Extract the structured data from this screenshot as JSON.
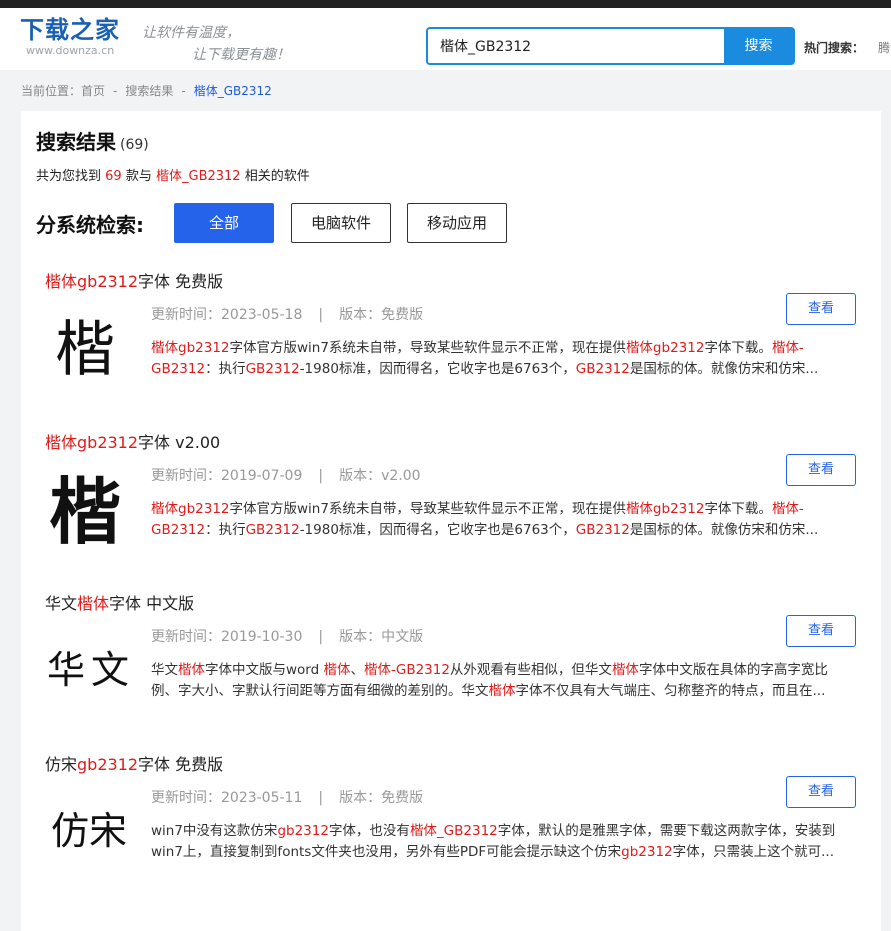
{
  "header": {
    "logo_title": "下载之家",
    "logo_url": "www.downza.cn",
    "slogan_line1": "让软件有温度，",
    "slogan_line2": "让下载更有趣！",
    "search_value": "楷体_GB2312",
    "search_button": "搜索",
    "hot_label": "热门搜索：",
    "hot_item": "腾讯"
  },
  "breadcrumb": {
    "prefix": "当前位置：",
    "home": "首页",
    "sep": "-",
    "results": "搜索结果",
    "current": "楷体_GB2312"
  },
  "results": {
    "title": "搜索结果",
    "count": "(69)",
    "summary_prefix": "共为您找到",
    "summary_count": "69",
    "summary_mid": "款与",
    "summary_keyword": "楷体_GB2312",
    "summary_suffix": "相关的软件"
  },
  "filter": {
    "label": "分系统检索:",
    "buttons": [
      "全部",
      "电脑软件",
      "移动应用"
    ]
  },
  "labels": {
    "updated": "更新时间：",
    "version": "版本：",
    "bar": "|",
    "view": "查看"
  },
  "items": [
    {
      "title_parts": [
        {
          "t": "楷体gb2312",
          "hl": true
        },
        {
          "t": "字体 免费版",
          "hl": false
        }
      ],
      "thumb_text": "楷",
      "date": "2023-05-18",
      "version": "免费版",
      "desc_parts": [
        {
          "t": "楷体gb2312",
          "hl": true
        },
        {
          "t": "字体官方版win7系统未自带，导致某些软件显示不正常，现在提供",
          "hl": false
        },
        {
          "t": "楷体gb2312",
          "hl": true
        },
        {
          "t": "字体下载。",
          "hl": false
        },
        {
          "t": "楷体-GB2312",
          "hl": true
        },
        {
          "t": "：执行",
          "hl": false
        },
        {
          "t": "GB2312",
          "hl": true
        },
        {
          "t": "-1980标准，因而得名，它收字也是6763个，",
          "hl": false
        },
        {
          "t": "GB2312",
          "hl": true
        },
        {
          "t": "是国标的体。就像仿宋和仿宋...",
          "hl": false
        }
      ]
    },
    {
      "title_parts": [
        {
          "t": "楷体gb2312",
          "hl": true
        },
        {
          "t": "字体 v2.00",
          "hl": false
        }
      ],
      "thumb_text": "楷",
      "date": "2019-07-09",
      "version": "v2.00",
      "desc_parts": [
        {
          "t": "楷体gb2312",
          "hl": true
        },
        {
          "t": "字体官方版win7系统未自带，导致某些软件显示不正常，现在提供",
          "hl": false
        },
        {
          "t": "楷体gb2312",
          "hl": true
        },
        {
          "t": "字体下载。",
          "hl": false
        },
        {
          "t": "楷体-GB2312",
          "hl": true
        },
        {
          "t": "：执行",
          "hl": false
        },
        {
          "t": "GB2312",
          "hl": true
        },
        {
          "t": "-1980标准，因而得名，它收字也是6763个，",
          "hl": false
        },
        {
          "t": "GB2312",
          "hl": true
        },
        {
          "t": "是国标的体。就像仿宋和仿宋...",
          "hl": false
        }
      ]
    },
    {
      "title_parts": [
        {
          "t": "华文",
          "hl": false
        },
        {
          "t": "楷体",
          "hl": true
        },
        {
          "t": "字体 中文版",
          "hl": false
        }
      ],
      "thumb_text": "华文",
      "date": "2019-10-30",
      "version": "中文版",
      "desc_parts": [
        {
          "t": "华文",
          "hl": false
        },
        {
          "t": "楷体",
          "hl": true
        },
        {
          "t": "字体中文版与word ",
          "hl": false
        },
        {
          "t": "楷体",
          "hl": true
        },
        {
          "t": "、",
          "hl": false
        },
        {
          "t": "楷体-GB2312",
          "hl": true
        },
        {
          "t": "从外观看有些相似，但华文",
          "hl": false
        },
        {
          "t": "楷体",
          "hl": true
        },
        {
          "t": "字体中文版在具体的字高字宽比例、字大小、字默认行间距等方面有细微的差别的。华文",
          "hl": false
        },
        {
          "t": "楷体",
          "hl": true
        },
        {
          "t": "字体不仅具有大气端庄、匀称整齐的特点，而且在...",
          "hl": false
        }
      ]
    },
    {
      "title_parts": [
        {
          "t": "仿宋",
          "hl": false
        },
        {
          "t": "gb2312",
          "hl": true
        },
        {
          "t": "字体 免费版",
          "hl": false
        }
      ],
      "thumb_text": "仿宋",
      "date": "2023-05-11",
      "version": "免费版",
      "desc_parts": [
        {
          "t": "win7中没有这款仿宋",
          "hl": false
        },
        {
          "t": "gb2312",
          "hl": true
        },
        {
          "t": "字体，也没有",
          "hl": false
        },
        {
          "t": "楷体_GB2312",
          "hl": true
        },
        {
          "t": "字体，默认的是雅黑字体，需要下载这两款字体，安装到win7上，直接复制到fonts文件夹也没用，另外有些PDF可能会提示缺这个仿宋",
          "hl": false
        },
        {
          "t": "gb2312",
          "hl": true
        },
        {
          "t": "字体，只需装上这个就可...",
          "hl": false
        }
      ]
    }
  ]
}
